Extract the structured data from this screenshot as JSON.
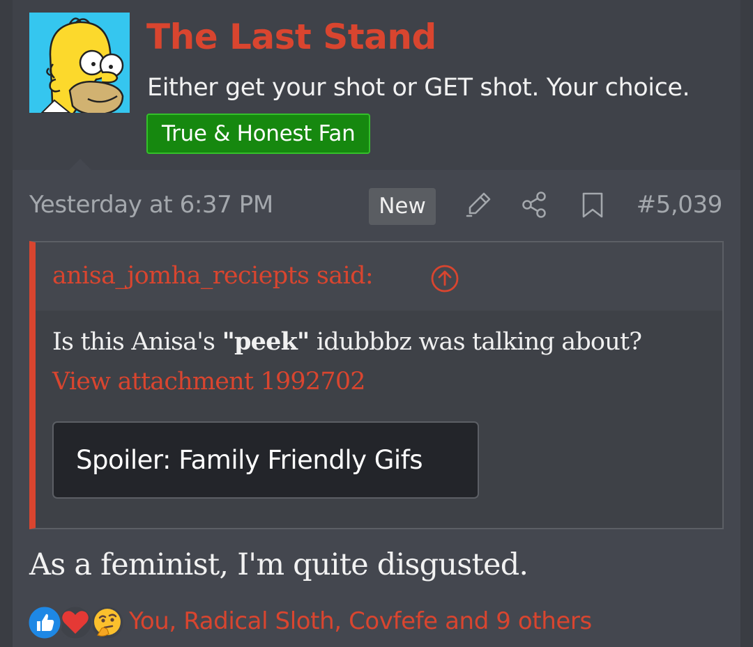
{
  "user": {
    "name": "The Last Stand",
    "title": "Either get your shot or GET shot. Your choice.",
    "banner": "True & Honest Fan",
    "avatar": "homer-simpson-avatar"
  },
  "post": {
    "date": "Yesterday at 6:37 PM",
    "new_label": "New",
    "number": "#5,039",
    "actions": [
      "edit-icon",
      "share-icon",
      "bookmark-icon"
    ],
    "quote": {
      "author": "anisa_jomha_reciepts said:",
      "text_before": "Is this Anisa's ",
      "text_bold": "\"peek\"",
      "text_after": " idubbbz was talking about?",
      "attachment": "View attachment 1992702",
      "spoiler": "Spoiler: Family Friendly Gifs"
    },
    "message": "As a feminist, I'm quite disgusted.",
    "reactions": {
      "icons": [
        "like-icon",
        "love-icon",
        "thinking-icon"
      ],
      "users": "You, Radical Sloth, Covfefe and 9 others"
    }
  },
  "colors": {
    "accent": "#d9452f",
    "banner_bg": "#16880f",
    "page_bg": "#3a3d43",
    "text": "#f2f2f2",
    "muted": "#a4a8ad"
  }
}
